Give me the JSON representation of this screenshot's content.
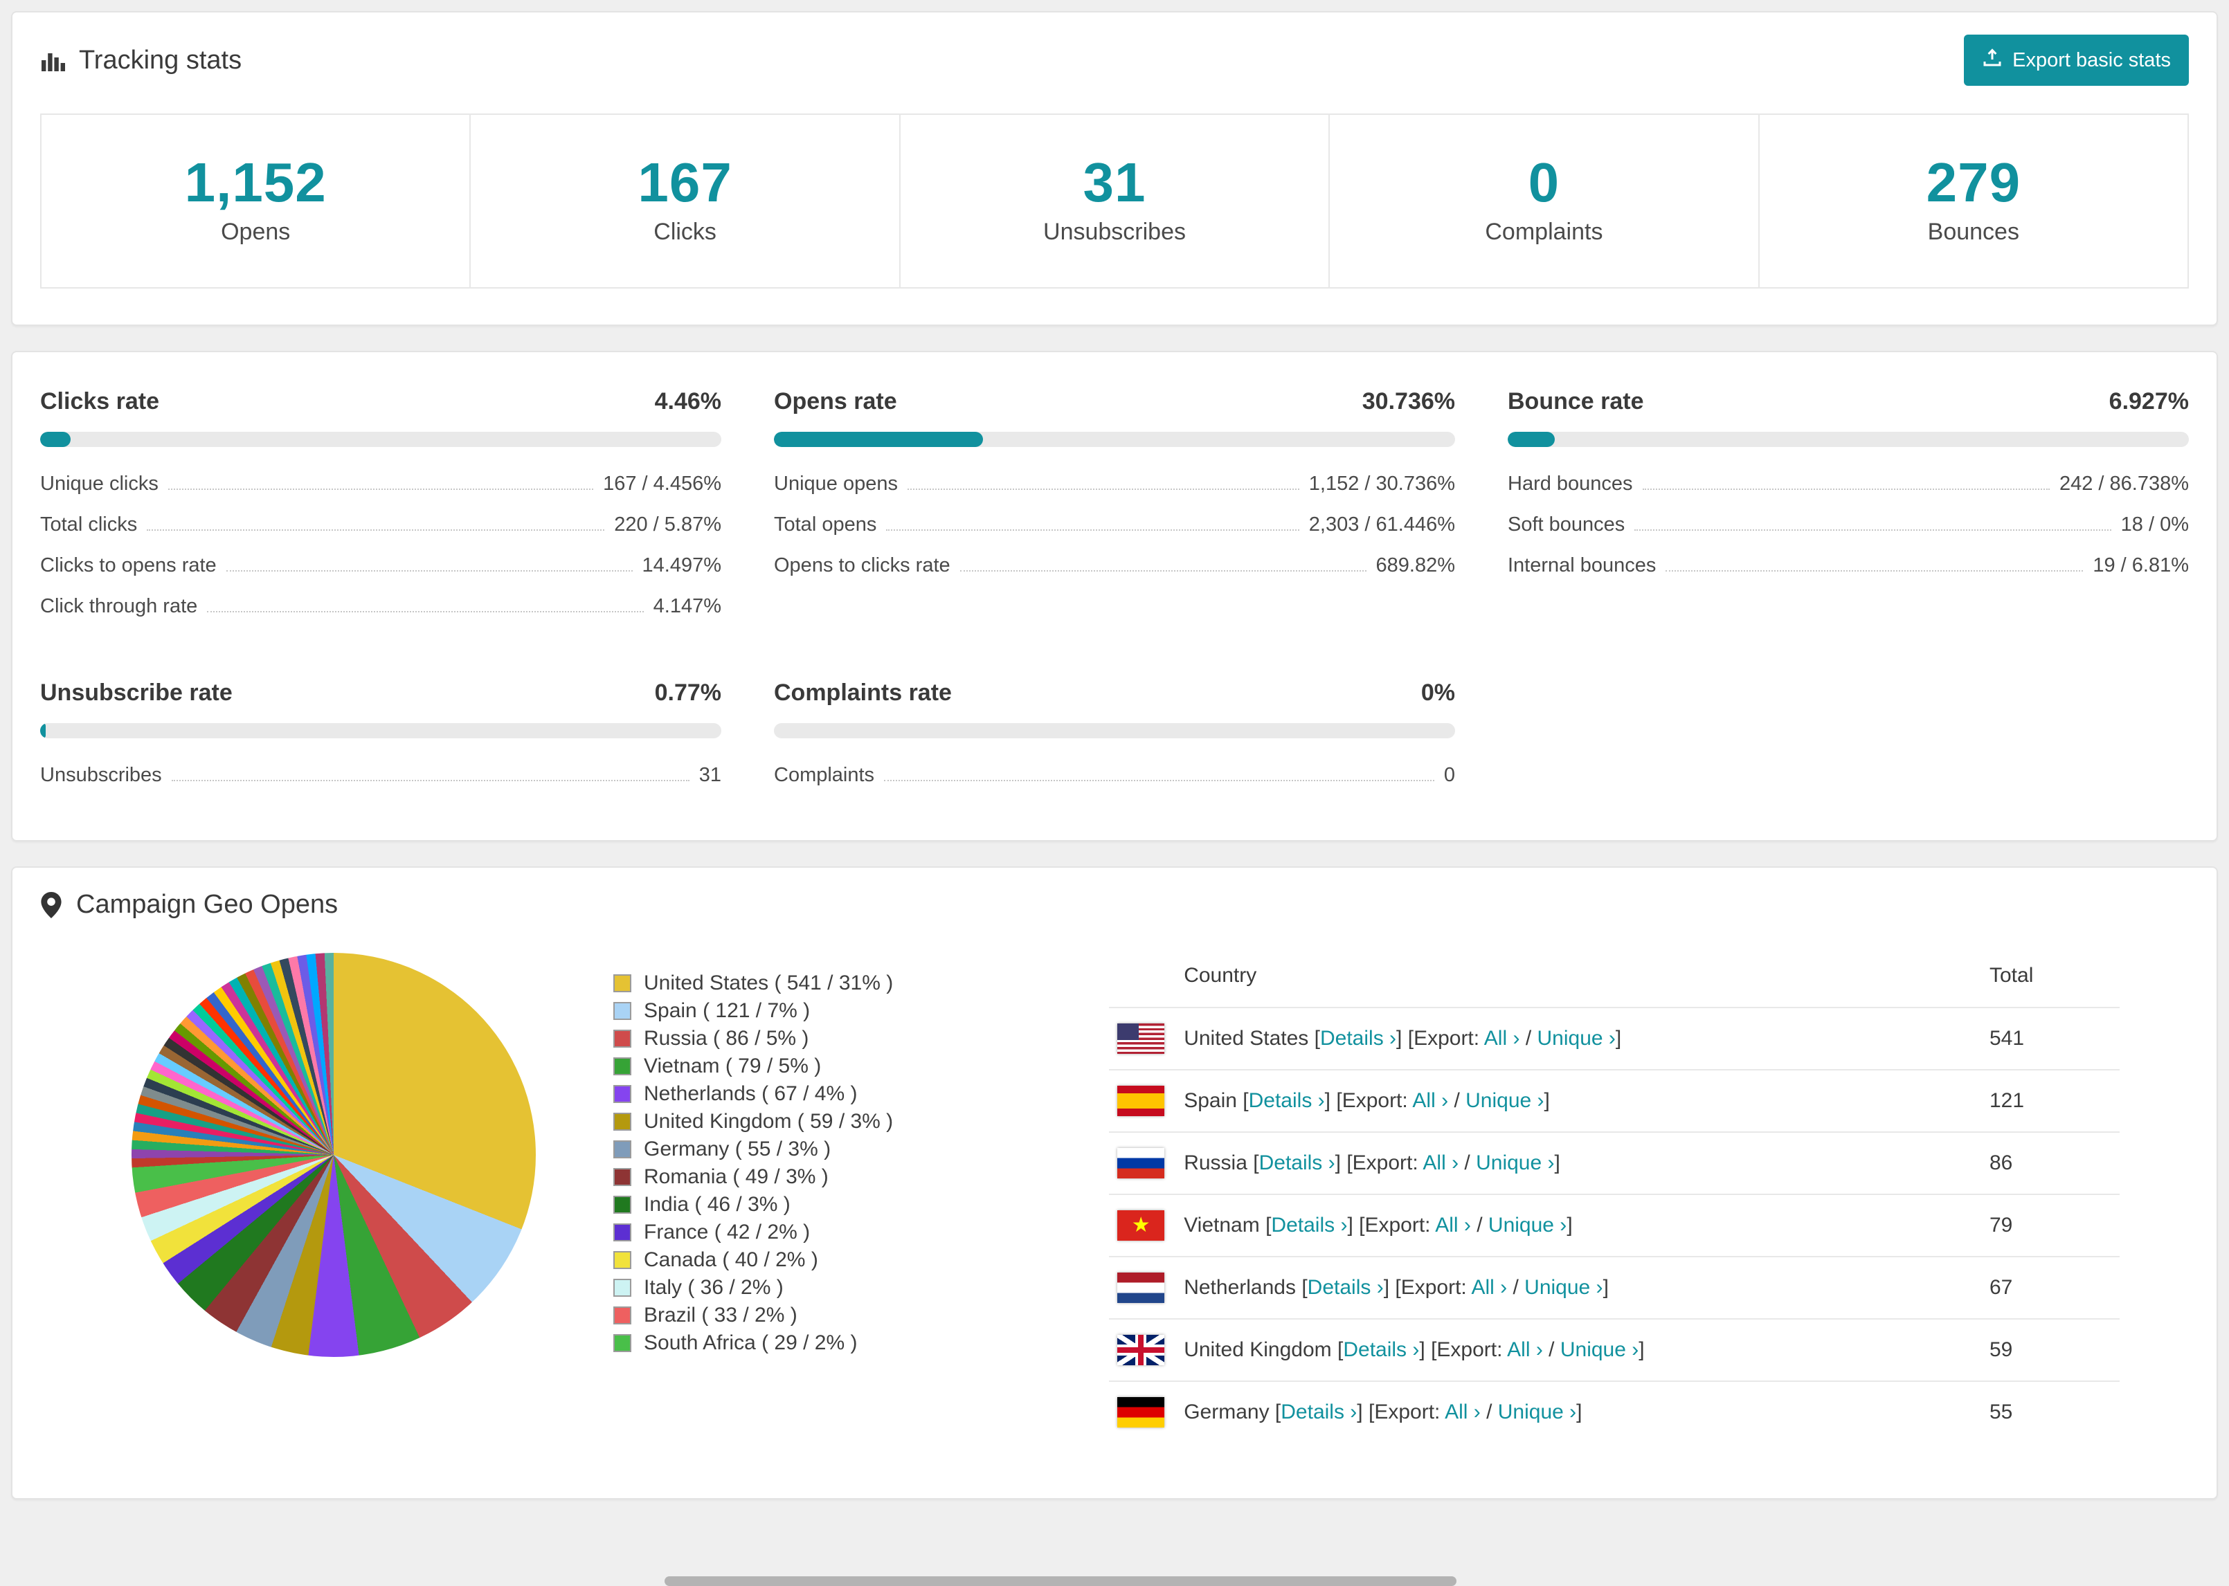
{
  "colors": {
    "accent": "#11919e",
    "page_bg": "#efefef"
  },
  "tracking": {
    "title": "Tracking stats",
    "export_button": "Export basic stats",
    "stats": [
      {
        "value": "1,152",
        "label": "Opens"
      },
      {
        "value": "167",
        "label": "Clicks"
      },
      {
        "value": "31",
        "label": "Unsubscribes"
      },
      {
        "value": "0",
        "label": "Complaints"
      },
      {
        "value": "279",
        "label": "Bounces"
      }
    ]
  },
  "rates": [
    {
      "title": "Clicks rate",
      "value": "4.46%",
      "percent": 4.46,
      "rows": [
        {
          "label": "Unique clicks",
          "value": "167 / 4.456%"
        },
        {
          "label": "Total clicks",
          "value": "220 / 5.87%"
        },
        {
          "label": "Clicks to opens rate",
          "value": "14.497%"
        },
        {
          "label": "Click through rate",
          "value": "4.147%"
        }
      ]
    },
    {
      "title": "Opens rate",
      "value": "30.736%",
      "percent": 30.736,
      "rows": [
        {
          "label": "Unique opens",
          "value": "1,152 / 30.736%"
        },
        {
          "label": "Total opens",
          "value": "2,303 / 61.446%"
        },
        {
          "label": "Opens to clicks rate",
          "value": "689.82%"
        }
      ]
    },
    {
      "title": "Bounce rate",
      "value": "6.927%",
      "percent": 6.927,
      "rows": [
        {
          "label": "Hard bounces",
          "value": "242 / 86.738%"
        },
        {
          "label": "Soft bounces",
          "value": "18 / 0%"
        },
        {
          "label": "Internal bounces",
          "value": "19 / 6.81%"
        }
      ]
    },
    {
      "title": "Unsubscribe rate",
      "value": "0.77%",
      "percent": 0.77,
      "rows": [
        {
          "label": "Unsubscribes",
          "value": "31"
        }
      ]
    },
    {
      "title": "Complaints rate",
      "value": "0%",
      "percent": 0,
      "rows": [
        {
          "label": "Complaints",
          "value": "0"
        }
      ]
    }
  ],
  "geo": {
    "title": "Campaign Geo Opens",
    "chart_data": {
      "type": "pie",
      "title": "Campaign Geo Opens",
      "labels": [
        "United States",
        "Spain",
        "Russia",
        "Vietnam",
        "Netherlands",
        "United Kingdom",
        "Germany",
        "Romania",
        "India",
        "France",
        "Canada",
        "Italy",
        "Brazil",
        "South Africa"
      ],
      "values": [
        541,
        121,
        86,
        79,
        67,
        59,
        55,
        49,
        46,
        42,
        40,
        36,
        33,
        29
      ],
      "percents": [
        31,
        7,
        5,
        5,
        4,
        3,
        3,
        3,
        3,
        2,
        2,
        2,
        2,
        2
      ],
      "colors": [
        "#e5c233",
        "#a9d3f5",
        "#cf4b4b",
        "#36a336",
        "#8544ef",
        "#b4990e",
        "#7f9cba",
        "#8e3434",
        "#20791f",
        "#5c2fd2",
        "#f1e23b",
        "#cdf3f3",
        "#ee6060",
        "#49bf49"
      ],
      "others_percent": 26,
      "legend_position": "right"
    },
    "table": {
      "headers": [
        "Country",
        "Total"
      ],
      "bracket_open": "[",
      "bracket_close": "]",
      "details_link": "Details ›",
      "export_prefix": "Export:",
      "all_link": "All ›",
      "separator": "/",
      "unique_link": "Unique ›",
      "rows": [
        {
          "country": "United States",
          "flag": "us",
          "total": "541"
        },
        {
          "country": "Spain",
          "flag": "es",
          "total": "121"
        },
        {
          "country": "Russia",
          "flag": "ru",
          "total": "86"
        },
        {
          "country": "Vietnam",
          "flag": "vn",
          "total": "79"
        },
        {
          "country": "Netherlands",
          "flag": "nl",
          "total": "67"
        },
        {
          "country": "United Kingdom",
          "flag": "gb",
          "total": "59"
        },
        {
          "country": "Germany",
          "flag": "de",
          "total": "55"
        }
      ]
    }
  }
}
